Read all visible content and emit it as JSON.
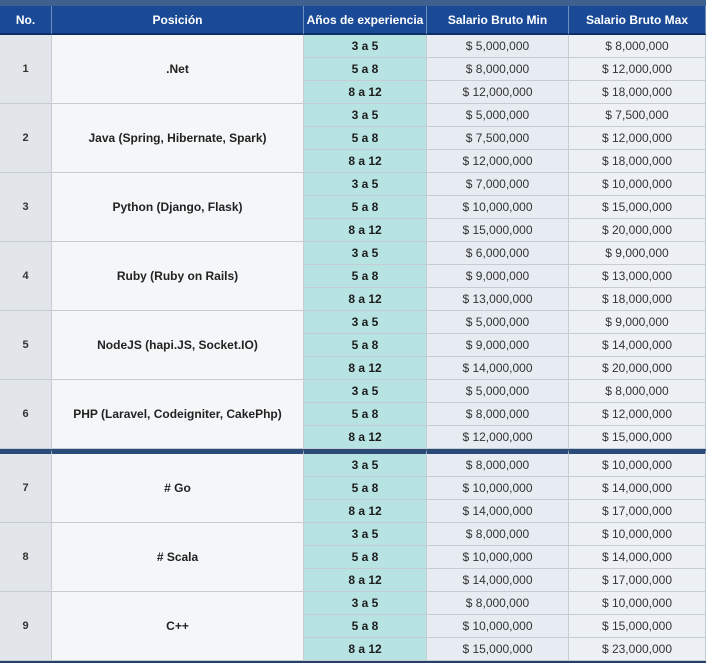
{
  "headers": [
    "No.",
    "Posición",
    "Años de experiencia",
    "Salario Bruto Min",
    "Salario Bruto Max"
  ],
  "rows": [
    {
      "no": "1",
      "position": ".Net",
      "levels": [
        {
          "years": "3 a 5",
          "min": "$ 5,000,000",
          "max": "$ 8,000,000"
        },
        {
          "years": "5 a 8",
          "min": "$ 8,000,000",
          "max": "$ 12,000,000"
        },
        {
          "years": "8 a 12",
          "min": "$ 12,000,000",
          "max": "$ 18,000,000"
        }
      ]
    },
    {
      "no": "2",
      "position": "Java (Spring, Hibernate, Spark)",
      "levels": [
        {
          "years": "3 a 5",
          "min": "$ 5,000,000",
          "max": "$ 7,500,000"
        },
        {
          "years": "5 a 8",
          "min": "$ 7,500,000",
          "max": "$ 12,000,000"
        },
        {
          "years": "8 a 12",
          "min": "$ 12,000,000",
          "max": "$ 18,000,000"
        }
      ]
    },
    {
      "no": "3",
      "position": "Python (Django, Flask)",
      "levels": [
        {
          "years": "3 a 5",
          "min": "$ 7,000,000",
          "max": "$ 10,000,000"
        },
        {
          "years": "5 a 8",
          "min": "$ 10,000,000",
          "max": "$ 15,000,000"
        },
        {
          "years": "8 a 12",
          "min": "$ 15,000,000",
          "max": "$ 20,000,000"
        }
      ]
    },
    {
      "no": "4",
      "position": "Ruby (Ruby on Rails)",
      "levels": [
        {
          "years": "3 a 5",
          "min": "$ 6,000,000",
          "max": "$ 9,000,000"
        },
        {
          "years": "5 a 8",
          "min": "$ 9,000,000",
          "max": "$ 13,000,000"
        },
        {
          "years": "8 a 12",
          "min": "$ 13,000,000",
          "max": "$ 18,000,000"
        }
      ]
    },
    {
      "no": "5",
      "position": "NodeJS (hapi.JS, Socket.IO)",
      "levels": [
        {
          "years": "3 a 5",
          "min": "$ 5,000,000",
          "max": "$ 9,000,000"
        },
        {
          "years": "5 a 8",
          "min": "$ 9,000,000",
          "max": "$ 14,000,000"
        },
        {
          "years": "8 a 12",
          "min": "$ 14,000,000",
          "max": "$ 20,000,000"
        }
      ]
    },
    {
      "no": "6",
      "position": "PHP (Laravel, Codeigniter, CakePhp)",
      "levels": [
        {
          "years": "3 a 5",
          "min": "$ 5,000,000",
          "max": "$ 8,000,000"
        },
        {
          "years": "5 a 8",
          "min": "$ 8,000,000",
          "max": "$ 12,000,000"
        },
        {
          "years": "8 a 12",
          "min": "$ 12,000,000",
          "max": "$ 15,000,000"
        }
      ]
    },
    {
      "no": "7",
      "position": "# Go",
      "levels": [
        {
          "years": "3 a 5",
          "min": "$ 8,000,000",
          "max": "$ 10,000,000"
        },
        {
          "years": "5 a 8",
          "min": "$ 10,000,000",
          "max": "$ 14,000,000"
        },
        {
          "years": "8 a 12",
          "min": "$ 14,000,000",
          "max": "$ 17,000,000"
        }
      ]
    },
    {
      "no": "8",
      "position": "# Scala",
      "levels": [
        {
          "years": "3 a 5",
          "min": "$ 8,000,000",
          "max": "$ 10,000,000"
        },
        {
          "years": "5 a 8",
          "min": "$ 10,000,000",
          "max": "$ 14,000,000"
        },
        {
          "years": "8 a 12",
          "min": "$ 14,000,000",
          "max": "$ 17,000,000"
        }
      ]
    },
    {
      "no": "9",
      "position": "C++",
      "levels": [
        {
          "years": "3 a 5",
          "min": "$ 8,000,000",
          "max": "$ 10,000,000"
        },
        {
          "years": "5 a 8",
          "min": "$ 10,000,000",
          "max": "$ 15,000,000"
        },
        {
          "years": "8 a 12",
          "min": "$ 15,000,000",
          "max": "$ 23,000,000"
        }
      ]
    }
  ]
}
